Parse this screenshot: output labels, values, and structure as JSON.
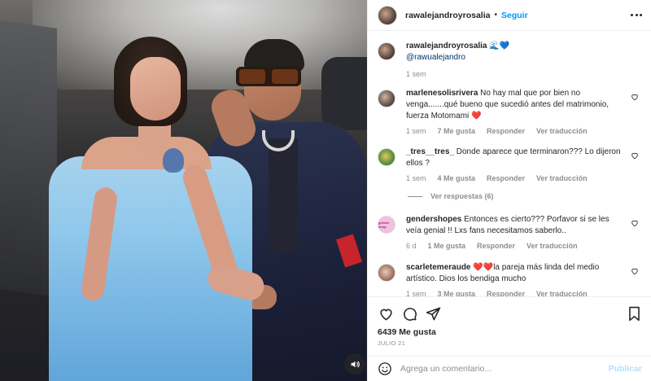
{
  "post": {
    "author": "rawalejandroyrosalia",
    "separator": "•",
    "follow_label": "Seguir",
    "caption_emoji": "🌊💙",
    "caption_mention": "@rawualejandro",
    "caption_time": "1 sem",
    "sound_icon": "speaker-icon"
  },
  "comments": [
    {
      "user": "marlenesolisrivera",
      "text": "No hay mal que por bien no venga.......qué bueno que sucedió antes del matrimonio, fuerza Motomami",
      "emoji": "❤️",
      "time": "1 sem",
      "likes": "7 Me gusta",
      "reply": "Responder",
      "translate": "Ver traducción"
    },
    {
      "user": "_tres__tres_",
      "text": "Donde aparece que terminaron??? Lo dijeron ellos ?",
      "emoji": "",
      "time": "1 sem",
      "likes": "4 Me gusta",
      "reply": "Responder",
      "translate": "Ver traducción",
      "view_replies": "Ver respuestas (6)"
    },
    {
      "user": "gendershopes",
      "text": "Entonces es cierto??? Porfavor si se les veía genial !! Lxs fans necesitamos saberlo..",
      "emoji": "",
      "time": "6 d",
      "likes": "1 Me gusta",
      "reply": "Responder",
      "translate": "Ver traducción",
      "avatar_text": "gender shop"
    },
    {
      "user": "scarletemeraude",
      "text": "la pareja más linda del medio artístico. Dios los bendiga mucho",
      "emoji": "❤️❤️",
      "time": "1 sem",
      "likes": "3 Me gusta",
      "reply": "Responder",
      "translate": "Ver traducción"
    }
  ],
  "actions": {
    "likes": "6439 Me gusta",
    "date": "JULIO 21"
  },
  "add_comment": {
    "placeholder": "Agrega un comentario...",
    "post_label": "Publicar"
  },
  "colors": {
    "accent": "#0095f6",
    "muted": "#8e8e8e",
    "text": "#262626",
    "post_disabled": "#b2dffc"
  }
}
